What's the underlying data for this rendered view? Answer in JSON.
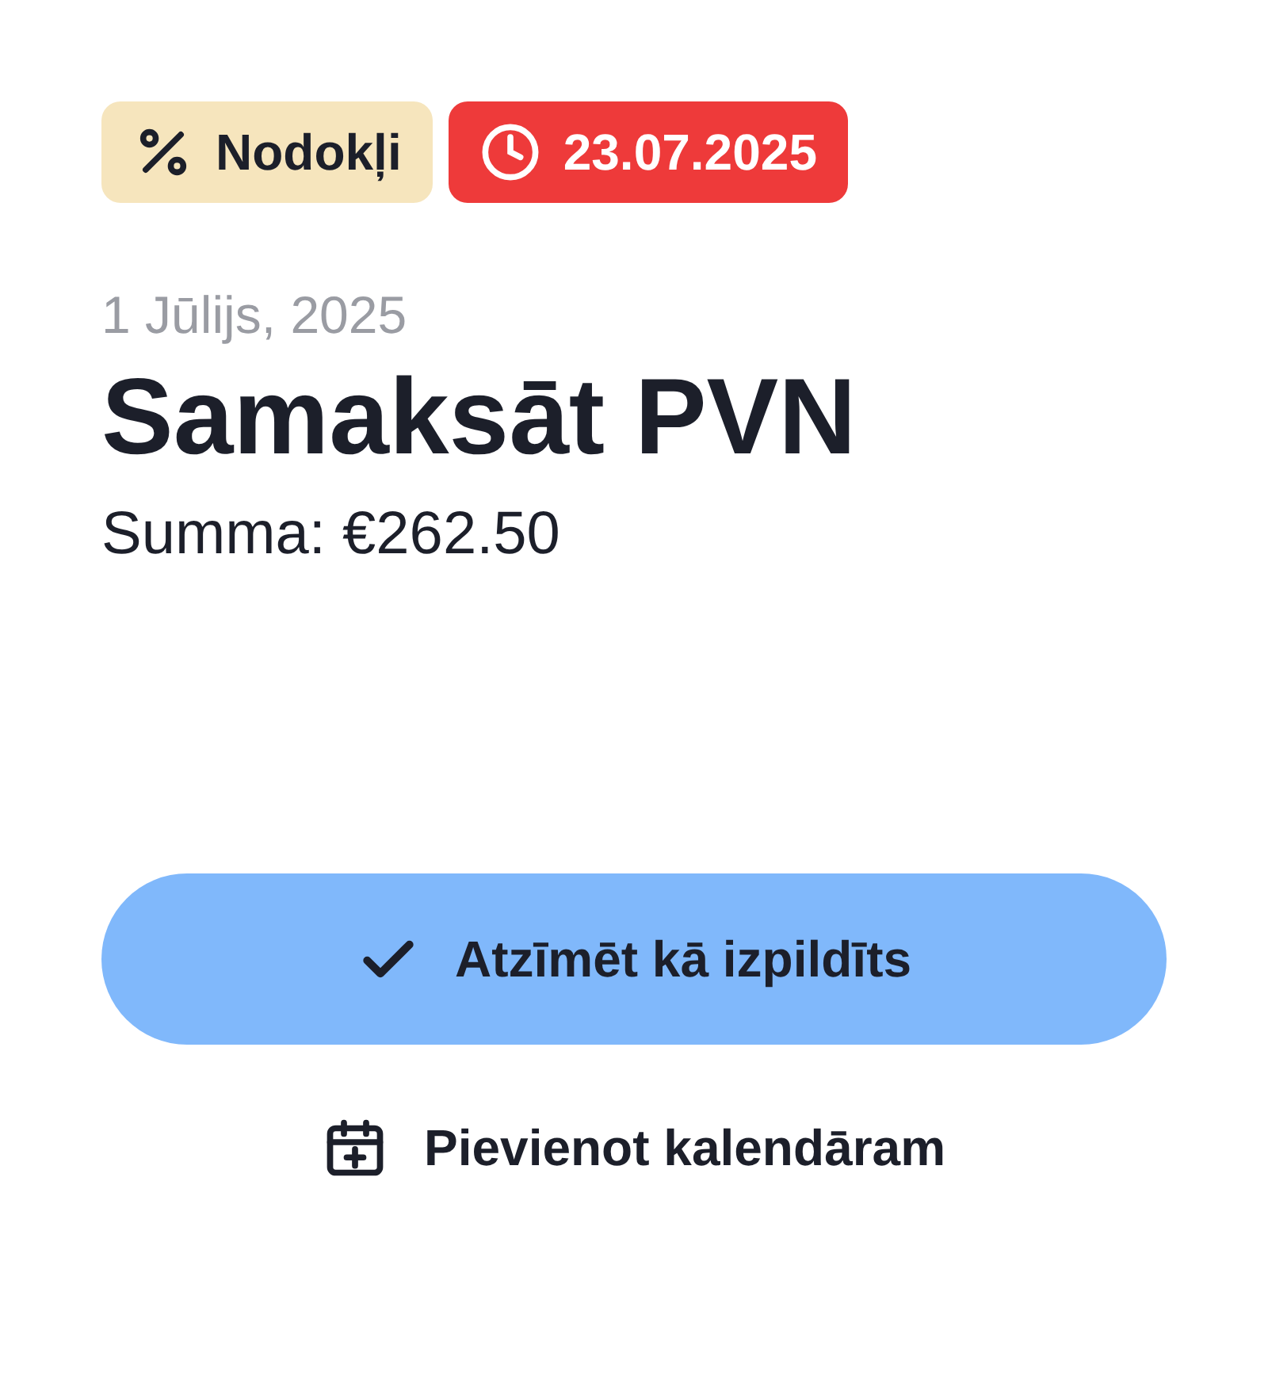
{
  "badges": [
    {
      "kind": "category",
      "label": "Nodokļi"
    },
    {
      "kind": "deadline",
      "label": "23.07.2025"
    }
  ],
  "date": "1 Jūlijs, 2025",
  "title": "Samaksāt PVN",
  "amount": "Summa: €262.50",
  "primary_button": {
    "label": "Atzīmēt kā izpildīts"
  },
  "secondary_link": {
    "label": "Pievienot kalendāram"
  }
}
